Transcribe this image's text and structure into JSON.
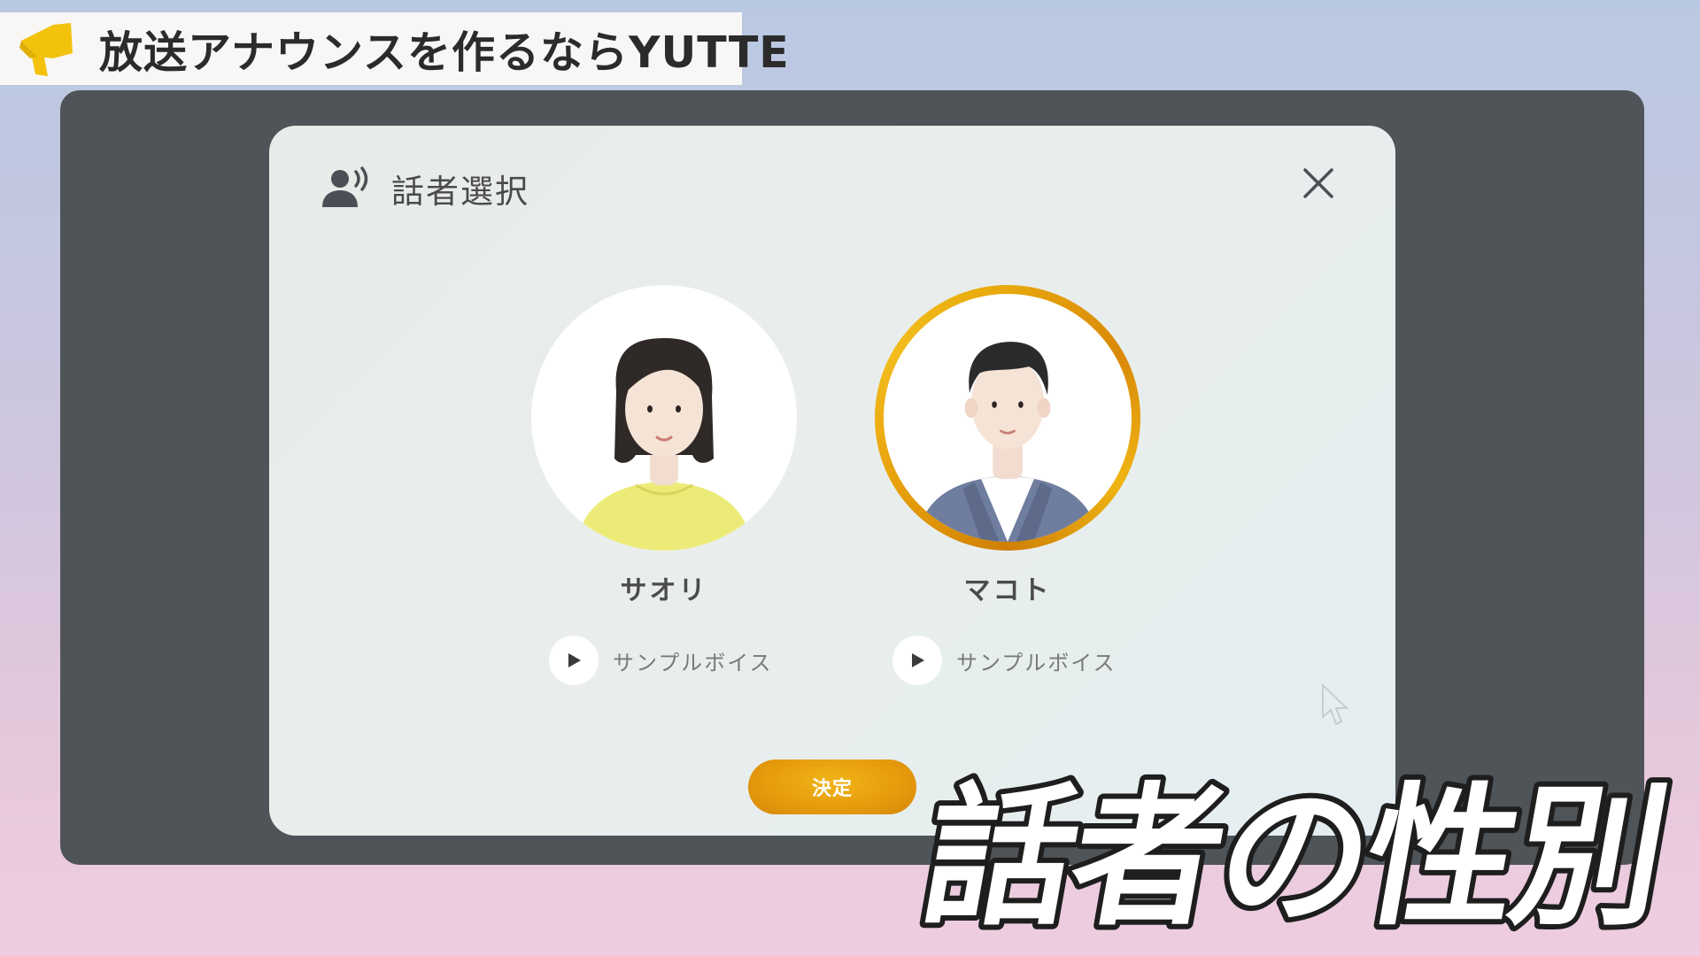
{
  "banner": {
    "text": "放送アナウンスを作るならYUTTE",
    "logo_icon": "megaphone-icon",
    "logo_color": "#f2c20c"
  },
  "modal": {
    "title": "話者選択",
    "header_icon": "speaker-voice-icon",
    "close_icon": "close-icon",
    "speakers": [
      {
        "name": "サオリ",
        "sample_label": "サンプルボイス",
        "selected": false,
        "avatar": "female-avatar"
      },
      {
        "name": "マコト",
        "sample_label": "サンプルボイス",
        "selected": true,
        "avatar": "male-avatar"
      }
    ],
    "confirm_label": "決定"
  },
  "caption": {
    "text": "話者の性別"
  },
  "colors": {
    "accent": "#e8a10b",
    "modal_bg": "#e8ece9",
    "screen_bg": "#4f5459",
    "banner_bg": "#f8f7f5"
  }
}
